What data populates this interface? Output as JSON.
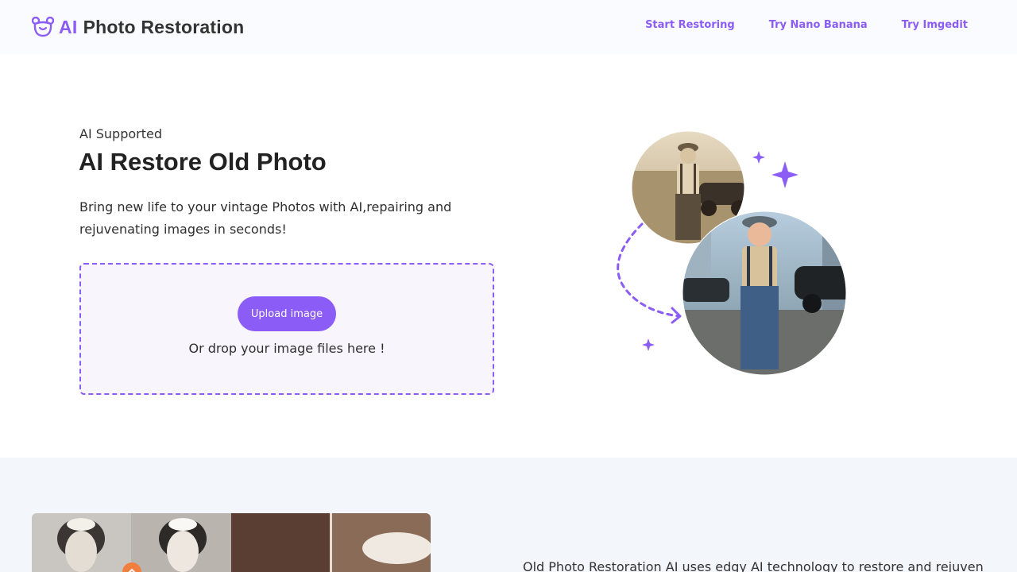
{
  "brand": {
    "ai": "AI",
    "name": "Photo Restoration",
    "accent_color": "#8b5cf6",
    "icon": "bear-face-icon"
  },
  "nav": {
    "items": [
      {
        "label": "Start Restoring"
      },
      {
        "label": "Try Nano Banana"
      },
      {
        "label": "Try Imgedit"
      }
    ]
  },
  "hero": {
    "eyebrow": "AI Supported",
    "title": "AI Restore Old Photo",
    "description": "Bring new life to your vintage Photos with AI,repairing and rejuvenating images in seconds!",
    "upload_button": "Upload image",
    "drop_hint": "Or drop your image files here !"
  },
  "section2": {
    "description": "Old Photo Restoration AI uses edgy AI technology to restore and rejuvenate"
  }
}
